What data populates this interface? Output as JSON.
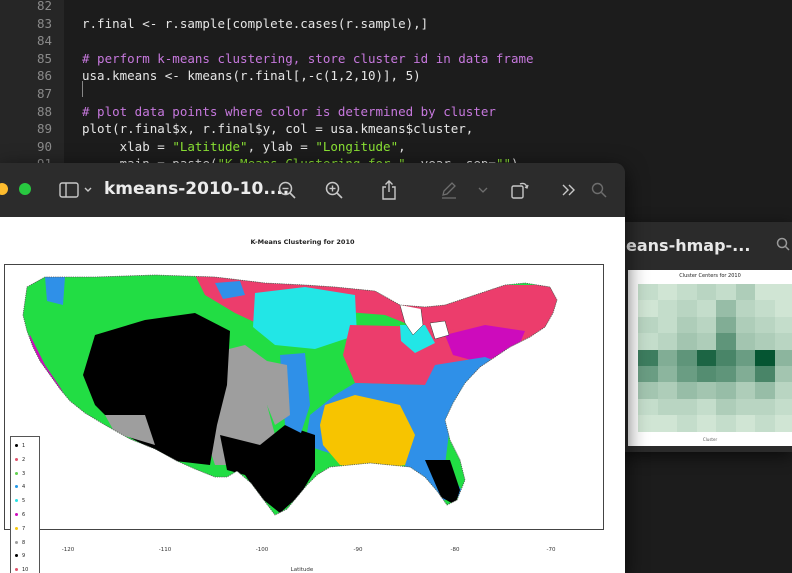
{
  "editor": {
    "lines": [
      {
        "num": "82",
        "text": ""
      },
      {
        "num": "83",
        "text": "r.final <- r.sample[complete.cases(r.sample),]"
      },
      {
        "num": "84",
        "text": ""
      },
      {
        "num": "85",
        "text": "# perform k-means clustering, store cluster id in data frame"
      },
      {
        "num": "86",
        "text": "usa.kmeans <- kmeans(r.final[,-c(1,2,10)], 5)"
      },
      {
        "num": "87",
        "text": ""
      },
      {
        "num": "88",
        "text": "# plot data points where color is determined by cluster"
      },
      {
        "num": "89",
        "text": "plot(r.final$x, r.final$y, col = usa.kmeans$cluster,"
      },
      {
        "num": "90",
        "text": "     xlab = \"Latitude\", ylab = \"Longitude\","
      },
      {
        "num": "91",
        "text": "     main = paste(\"K-Means Clustering for \", year, sep=\"\"),"
      }
    ],
    "colors": {
      "comment": "#c678dd",
      "string": "#8ae234",
      "text": "#e6e6e6"
    }
  },
  "preview_window": {
    "title": "kmeans-2010-10....",
    "icons": [
      "sidebar-icon",
      "chevron-down-icon",
      "zoom-out-icon",
      "zoom-in-icon",
      "share-icon",
      "markup-icon",
      "chevron-down-icon",
      "rotate-icon",
      "more-icon",
      "search-icon"
    ]
  },
  "heatmap_window": {
    "title": "eans-hmap-...",
    "plot_title": "Cluster Centers for 2010",
    "xlabel": "Cluster"
  },
  "chart_data": [
    {
      "type": "scatter",
      "title": "K-Means Clustering for 2010",
      "xlabel": "Latitude",
      "ylabel": "",
      "xlim": [
        -125,
        -66
      ],
      "x_ticks": [
        "-120",
        "-110",
        "-100",
        "-90",
        "-80",
        "-70"
      ],
      "legend": {
        "placement": "left",
        "entries": [
          {
            "label": "1",
            "color": "#000000"
          },
          {
            "label": "2",
            "color": "#df536b"
          },
          {
            "label": "3",
            "color": "#61d04f"
          },
          {
            "label": "4",
            "color": "#2297e6"
          },
          {
            "label": "5",
            "color": "#28e2e5"
          },
          {
            "label": "6",
            "color": "#cd0bbc"
          },
          {
            "label": "7",
            "color": "#f5c710"
          },
          {
            "label": "8",
            "color": "#9e9e9e"
          },
          {
            "label": "9",
            "color": "#000000"
          },
          {
            "label": "10",
            "color": "#df536b"
          }
        ]
      },
      "regions": [
        {
          "cluster": "3",
          "color": "#22dd44",
          "area": "northwest and northern plains"
        },
        {
          "cluster": "2",
          "color": "#ec3d6c",
          "area": "north central and midwest"
        },
        {
          "cluster": "5",
          "color": "#22e6e6",
          "area": "upper midwest"
        },
        {
          "cluster": "1",
          "color": "#000000",
          "area": "southwest and texas"
        },
        {
          "cluster": "8",
          "color": "#9e9e9e",
          "area": "central plains band"
        },
        {
          "cluster": "4",
          "color": "#2f90e8",
          "area": "southeast and appalachia"
        },
        {
          "cluster": "7",
          "color": "#f7c400",
          "area": "south central"
        },
        {
          "cluster": "6",
          "color": "#e040e0",
          "area": "pacific coast"
        }
      ]
    },
    {
      "type": "heatmap",
      "title": "Cluster Centers for 2010",
      "xlabel": "Cluster",
      "rows": 9,
      "cols": 8,
      "values": [
        [
          0.15,
          0.1,
          0.15,
          0.2,
          0.15,
          0.25,
          0.1,
          0.1
        ],
        [
          0.1,
          0.15,
          0.2,
          0.15,
          0.35,
          0.2,
          0.15,
          0.1
        ],
        [
          0.2,
          0.15,
          0.25,
          0.2,
          0.45,
          0.25,
          0.2,
          0.15
        ],
        [
          0.15,
          0.2,
          0.3,
          0.25,
          0.6,
          0.3,
          0.25,
          0.2
        ],
        [
          0.75,
          0.45,
          0.6,
          0.9,
          0.7,
          0.55,
          1.0,
          0.4
        ],
        [
          0.55,
          0.4,
          0.55,
          0.65,
          0.6,
          0.45,
          0.7,
          0.3
        ],
        [
          0.3,
          0.25,
          0.35,
          0.3,
          0.35,
          0.25,
          0.35,
          0.2
        ],
        [
          0.15,
          0.2,
          0.2,
          0.15,
          0.25,
          0.2,
          0.2,
          0.15
        ],
        [
          0.1,
          0.1,
          0.15,
          0.1,
          0.15,
          0.1,
          0.15,
          0.1
        ]
      ]
    }
  ]
}
